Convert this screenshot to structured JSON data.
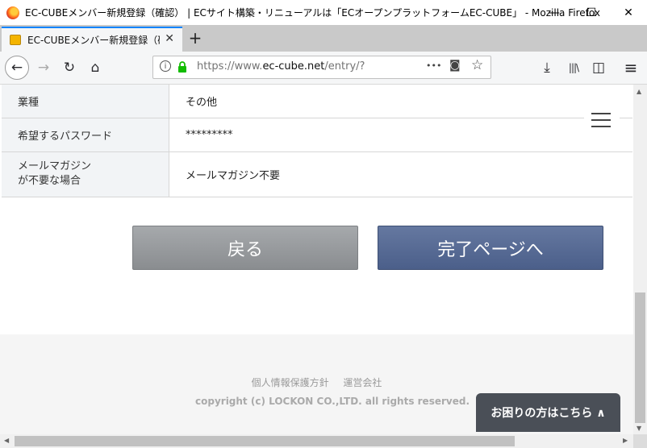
{
  "window": {
    "title": "EC-CUBEメンバー新規登録（確認） | ECサイト構築・リニューアルは「ECオープンプラットフォームEC-CUBE」 - Mozilla Firefox",
    "minimize": "—",
    "maximize": "☐",
    "close": "✕"
  },
  "tab": {
    "label": "EC-CUBEメンバー新規登録（確認）",
    "close": "✕",
    "new_tab": "+"
  },
  "nav": {
    "back": "←",
    "forward": "→",
    "reload": "↻",
    "home": "⌂",
    "url_prefix": "https://www.",
    "url_domain": "ec-cube.net",
    "url_path": "/entry/?",
    "more": "•••",
    "pocket": "◙",
    "star": "☆",
    "download": "⤓",
    "library": "|||\\",
    "sidebar": "◫",
    "menu": "≡"
  },
  "form": {
    "rows": [
      {
        "label": "業種",
        "value": "その他"
      },
      {
        "label": "希望するパスワード",
        "value": "*********"
      },
      {
        "label": "メールマガジン\nが不要な場合",
        "value": "メールマガジン不要"
      }
    ]
  },
  "buttons": {
    "back": "戻る",
    "next": "完了ページへ"
  },
  "footer": {
    "privacy": "個人情報保護方針",
    "company": "運営会社",
    "copyright": "copyright (c) LOCKON CO.,LTD. all rights reserved."
  },
  "help": {
    "label": "お困りの方はこちら ∧"
  }
}
